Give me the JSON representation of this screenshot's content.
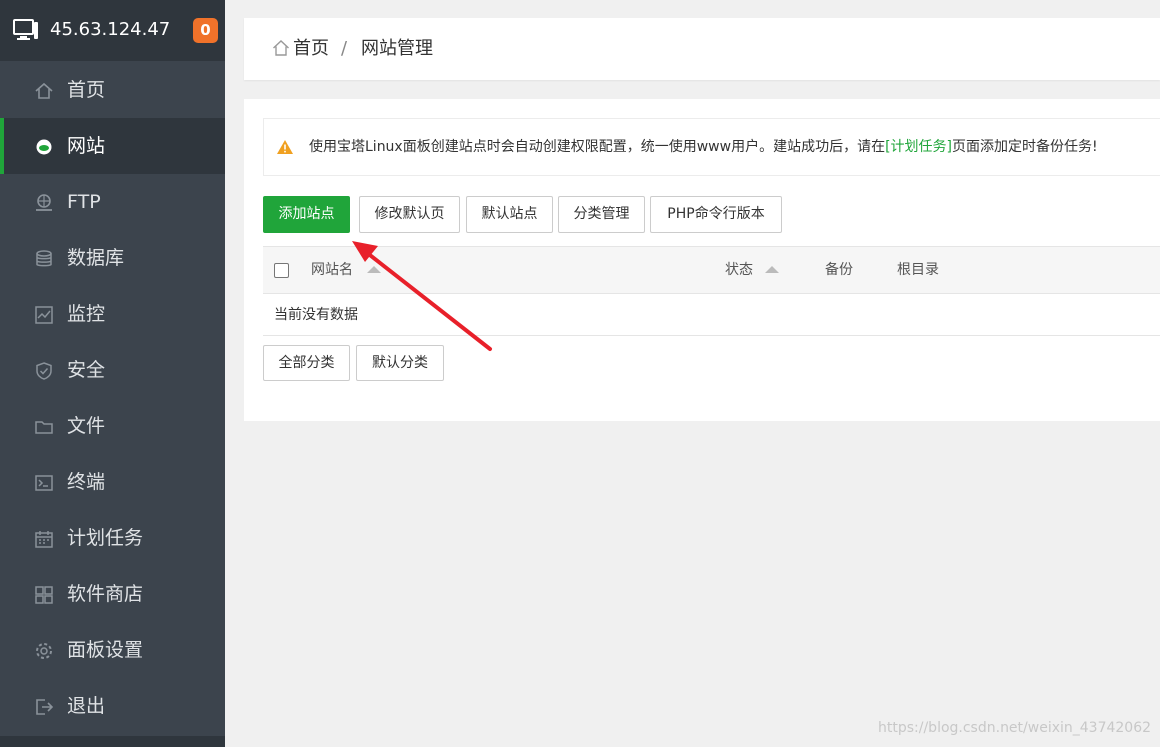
{
  "server": {
    "ip": "45.63.124.47",
    "badge": "0"
  },
  "sidebar": {
    "items": [
      {
        "label": "首页",
        "icon": "home-icon",
        "active": false
      },
      {
        "label": "网站",
        "icon": "globe-icon",
        "active": true
      },
      {
        "label": "FTP",
        "icon": "ftp-icon",
        "active": false
      },
      {
        "label": "数据库",
        "icon": "database-icon",
        "active": false
      },
      {
        "label": "监控",
        "icon": "monitor-icon",
        "active": false
      },
      {
        "label": "安全",
        "icon": "shield-icon",
        "active": false
      },
      {
        "label": "文件",
        "icon": "folder-icon",
        "active": false
      },
      {
        "label": "终端",
        "icon": "terminal-icon",
        "active": false
      },
      {
        "label": "计划任务",
        "icon": "calendar-icon",
        "active": false
      },
      {
        "label": "软件商店",
        "icon": "grid-icon",
        "active": false
      },
      {
        "label": "面板设置",
        "icon": "gear-icon",
        "active": false
      },
      {
        "label": "退出",
        "icon": "logout-icon",
        "active": false
      }
    ]
  },
  "breadcrumb": {
    "home": "首页",
    "separator": "/",
    "current": "网站管理"
  },
  "alert": {
    "text_before": "使用宝塔Linux面板创建站点时会自动创建权限配置，统一使用www用户。建站成功后，请在",
    "link": "[计划任务]",
    "text_after": "页面添加定时备份任务!"
  },
  "toolbar": {
    "add_site": "添加站点",
    "edit_default_page": "修改默认页",
    "default_site": "默认站点",
    "category_manage": "分类管理",
    "php_cli_version": "PHP命令行版本"
  },
  "table": {
    "headers": {
      "name": "网站名",
      "status": "状态",
      "backup": "备份",
      "root": "根目录"
    },
    "empty_text": "当前没有数据"
  },
  "categories": {
    "all": "全部分类",
    "default": "默认分类"
  },
  "watermark": "https://blog.csdn.net/weixin_43742062",
  "colors": {
    "accent": "#20a53a",
    "sidebar": "#3c444d",
    "badge": "#f0722a",
    "annotation_arrow": "#e8202a"
  }
}
